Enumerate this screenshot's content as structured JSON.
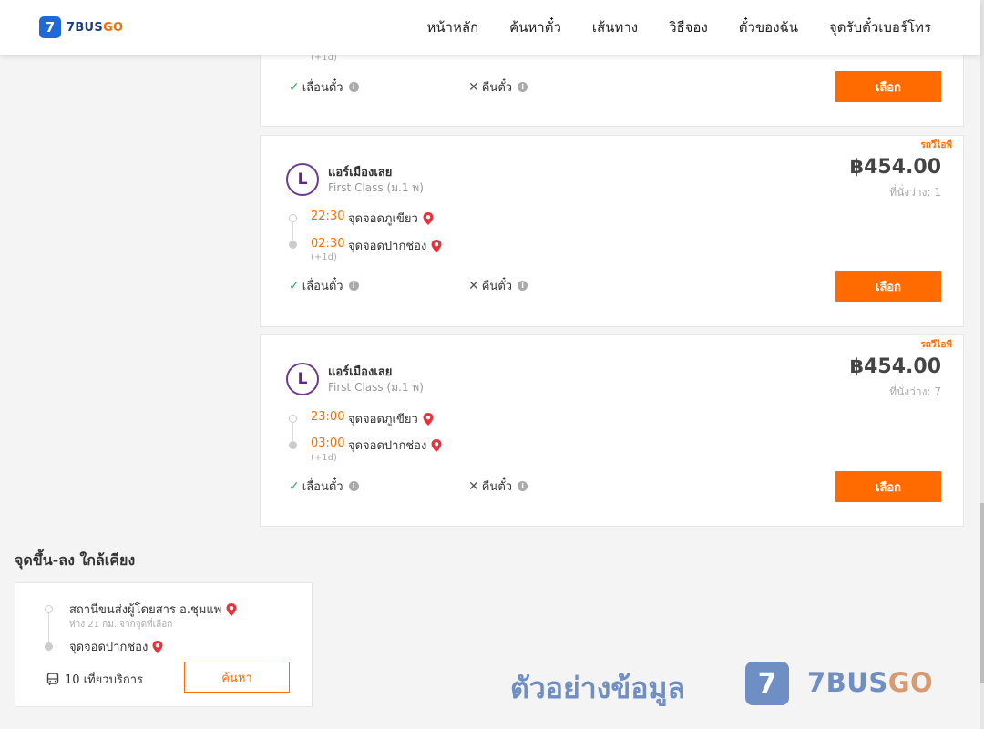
{
  "header": {
    "logo_badge": "7",
    "logo_text_a": "7BUS",
    "logo_text_b": "GO",
    "nav": [
      "หน้าหลัก",
      "ค้นหาตั๋ว",
      "เส้นทาง",
      "วิธีจอง",
      "ตั๋วของฉัน",
      "จุดรับตั๋วเบอร์โทร"
    ]
  },
  "top_card": {
    "plus_day": "(+1d)",
    "feature_reschedule": "เลื่อนตั๋ว",
    "feature_refund": "คืนตั๋ว",
    "select_label": "เลือก"
  },
  "trips": [
    {
      "vip_tag": "รถวีไอพี",
      "logo_letter": "L",
      "operator": "แอร์เมืองเลย",
      "bus_class": "First Class (ม.1 พ)",
      "price": "฿454.00",
      "seats": "ที่นั่งว่าง: 1",
      "depart_time": "22:30",
      "depart_stop": "จุดจอดภูเขียว",
      "arrive_time": "02:30",
      "arrive_stop": "จุดจอดปากช่อง",
      "plus_day": "(+1d)",
      "feature_reschedule": "เลื่อนตั๋ว",
      "feature_refund": "คืนตั๋ว",
      "select_label": "เลือก"
    },
    {
      "vip_tag": "รถวีไอพี",
      "logo_letter": "L",
      "operator": "แอร์เมืองเลย",
      "bus_class": "First Class (ม.1 พ)",
      "price": "฿454.00",
      "seats": "ที่นั่งว่าง: 7",
      "depart_time": "23:00",
      "depart_stop": "จุดจอดภูเขียว",
      "arrive_time": "03:00",
      "arrive_stop": "จุดจอดปากช่อง",
      "plus_day": "(+1d)",
      "feature_reschedule": "เลื่อนตั๋ว",
      "feature_refund": "คืนตั๋ว",
      "select_label": "เลือก"
    }
  ],
  "nearby": {
    "title": "จุดขึ้น-ลง ใกล้เคียง",
    "stop1": "สถานีขนส่งผู้โดยสาร อ.ชุมแพ",
    "distance": "ห่าง 21 กม. จากจุดที่เลือก",
    "stop2": "จุดจอดปากช่อง",
    "trips": "10 เที่ยวบริการ",
    "search_label": "ค้นหา"
  },
  "watermark": {
    "text": "ตัวอย่างข้อมูล",
    "badge": "7",
    "logo_a": "7BUS",
    "logo_b": "GO"
  },
  "colors": {
    "accent": "#ff6b00",
    "brand_blue": "#1f6ad8",
    "check_green": "#2ea84b",
    "pin_red": "#e8323c"
  }
}
